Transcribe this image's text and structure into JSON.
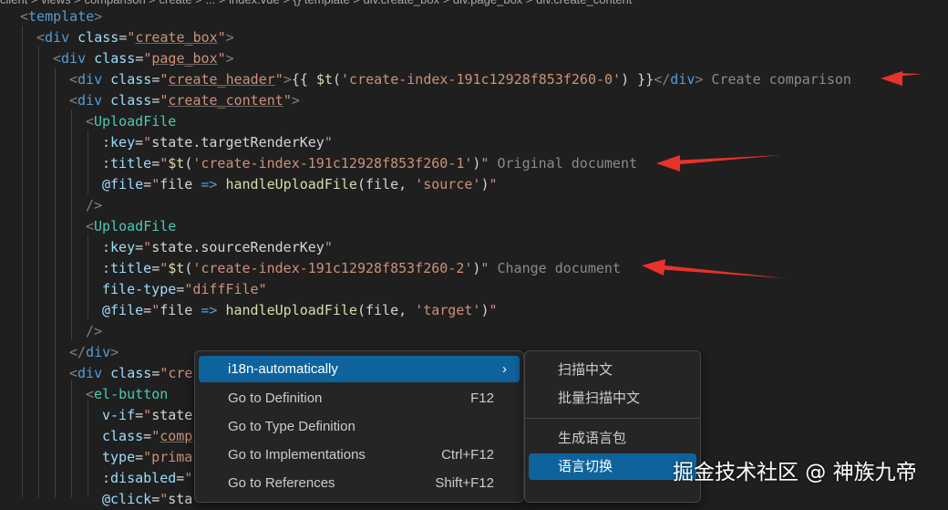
{
  "breadcrumb": {
    "text": "client > views > comparison > create > ... > index.vue > {} template > div.create_box > div.page_box > div.create_content"
  },
  "code_lines": [
    "<template>",
    "<div class=\"create_box\">",
    "<div class=\"page_box\">",
    "<div class=\"create_header\">{{ $t('create-index-191c12928f853f260-0') }}</div>",
    "<div class=\"create_content\">",
    "<UploadFile",
    ":key=\"state.targetRenderKey\"",
    ":title=\"$t('create-index-191c12928f853f260-1')\"",
    "@file=\"file => handleUploadFile(file, 'source')\"",
    "/>",
    "<UploadFile",
    ":key=\"state.sourceRenderKey\"",
    ":title=\"$t('create-index-191c12928f853f260-2')\"",
    "file-type=\"diffFile\"",
    "@file=\"file => handleUploadFile(file, 'target')\"",
    "/>",
    "</div>",
    "<div class=\"cre",
    "<el-button",
    "v-if=\"state",
    "class=\"comp",
    "type=\"prima",
    ":disabled=\"",
    "@click=\"sta"
  ],
  "inline_hints": {
    "header": "Create comparison",
    "original": "Original document",
    "change": "Change document"
  },
  "context_menu": {
    "items": [
      {
        "label": "i18n-automatically",
        "shortcut": "",
        "has_submenu": true
      },
      {
        "label": "Go to Definition",
        "shortcut": "F12"
      },
      {
        "label": "Go to Type Definition",
        "shortcut": ""
      },
      {
        "label": "Go to Implementations",
        "shortcut": "Ctrl+F12"
      },
      {
        "label": "Go to References",
        "shortcut": "Shift+F12"
      }
    ],
    "submenu_glyph": "›"
  },
  "submenu": {
    "items": [
      {
        "label": "扫描中文"
      },
      {
        "label": "批量扫描中文"
      },
      {
        "label": "生成语言包"
      },
      {
        "label": "语言切换"
      }
    ]
  },
  "watermark": {
    "text": "掘金技术社区 @ 神族九帝"
  },
  "colors": {
    "background": "#1f1f1f",
    "menu_highlight": "#0e639c",
    "arrow": "#e8322a"
  }
}
